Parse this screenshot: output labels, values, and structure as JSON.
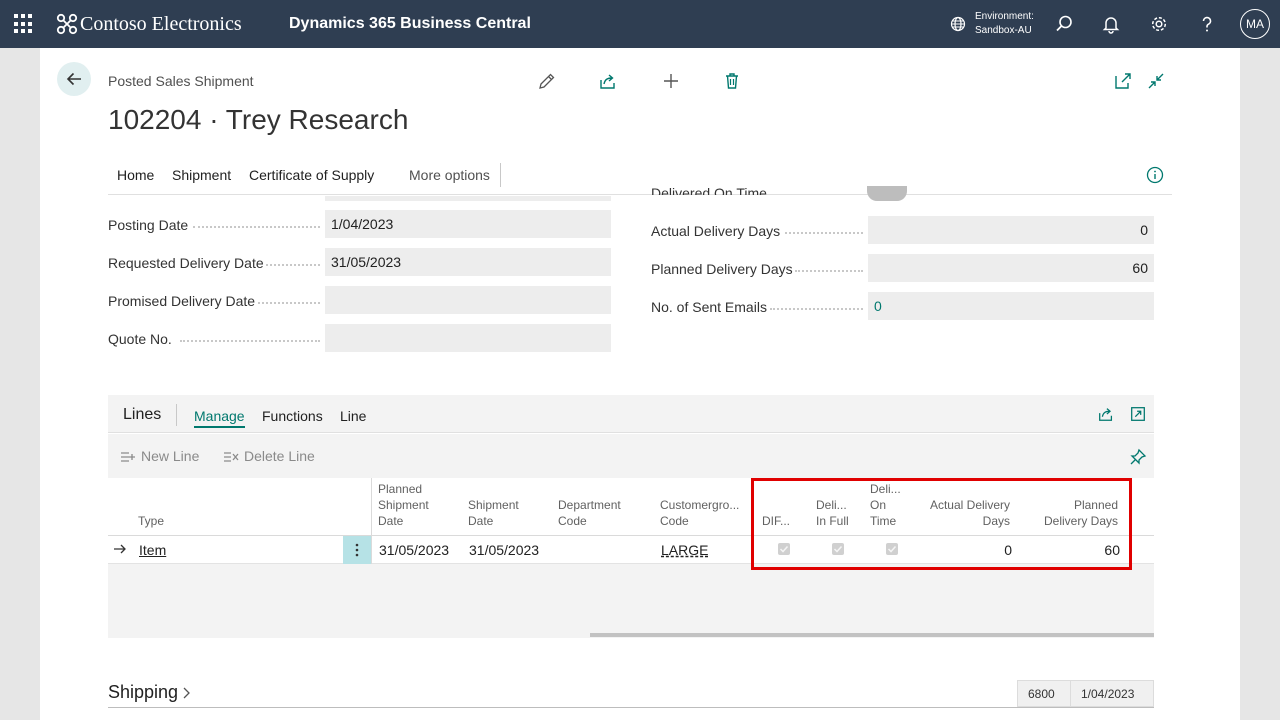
{
  "topbar": {
    "brand": "Contoso Electronics",
    "app": "Dynamics 365 Business Central",
    "env_label": "Environment:",
    "env_value": "Sandbox-AU",
    "user_initials": "MA"
  },
  "page": {
    "breadcrumb": "Posted Sales Shipment",
    "title": "102204 · Trey Research"
  },
  "menu": {
    "items": [
      "Home",
      "Shipment",
      "Certificate of Supply"
    ],
    "more": "More options"
  },
  "fields_left": [
    {
      "label": "Posting Date",
      "value": "1/04/2023"
    },
    {
      "label": "Requested Delivery Date",
      "value": "31/05/2023"
    },
    {
      "label": "Promised Delivery Date",
      "value": ""
    },
    {
      "label": "Quote No.",
      "value": ""
    }
  ],
  "fields_right": {
    "cut_label": "Delivered On Time",
    "items": [
      {
        "label": "Actual Delivery Days",
        "value": "0"
      },
      {
        "label": "Planned Delivery Days",
        "value": "60"
      },
      {
        "label": "No. of Sent Emails",
        "value": "0"
      }
    ]
  },
  "lines": {
    "title": "Lines",
    "tabs": [
      "Manage",
      "Functions",
      "Line"
    ],
    "active_tab": "Manage",
    "new_line": "New Line",
    "delete_line": "Delete Line",
    "columns": {
      "type": "Type",
      "planned_shipment_date": [
        "Planned",
        "Shipment",
        "Date"
      ],
      "shipment_date": [
        "Shipment",
        "Date"
      ],
      "department_code": [
        "Department",
        "Code"
      ],
      "customergroup_code": [
        "Customergro...",
        "Code"
      ],
      "dif": "DIF...",
      "delivered_in_full": [
        "Deli...",
        "In Full"
      ],
      "delivered_on_time": [
        "Deli...",
        "On",
        "Time"
      ],
      "actual_delivery_days": [
        "Actual Delivery",
        "Days"
      ],
      "planned_delivery_days": [
        "Planned",
        "Delivery Days"
      ]
    },
    "row": {
      "type": "Item",
      "planned_shipment_date": "31/05/2023",
      "shipment_date": "31/05/2023",
      "department_code": "",
      "customergroup_code": "LARGE",
      "dif": true,
      "delivered_in_full": true,
      "delivered_on_time": true,
      "actual_delivery_days": "0",
      "planned_delivery_days": "60"
    }
  },
  "shipping": {
    "title": "Shipping",
    "summary_value": "6800",
    "summary_date": "1/04/2023"
  },
  "colors": {
    "topbar": "#2f3e52",
    "accent": "#00786e",
    "highlight": "#e00000"
  }
}
